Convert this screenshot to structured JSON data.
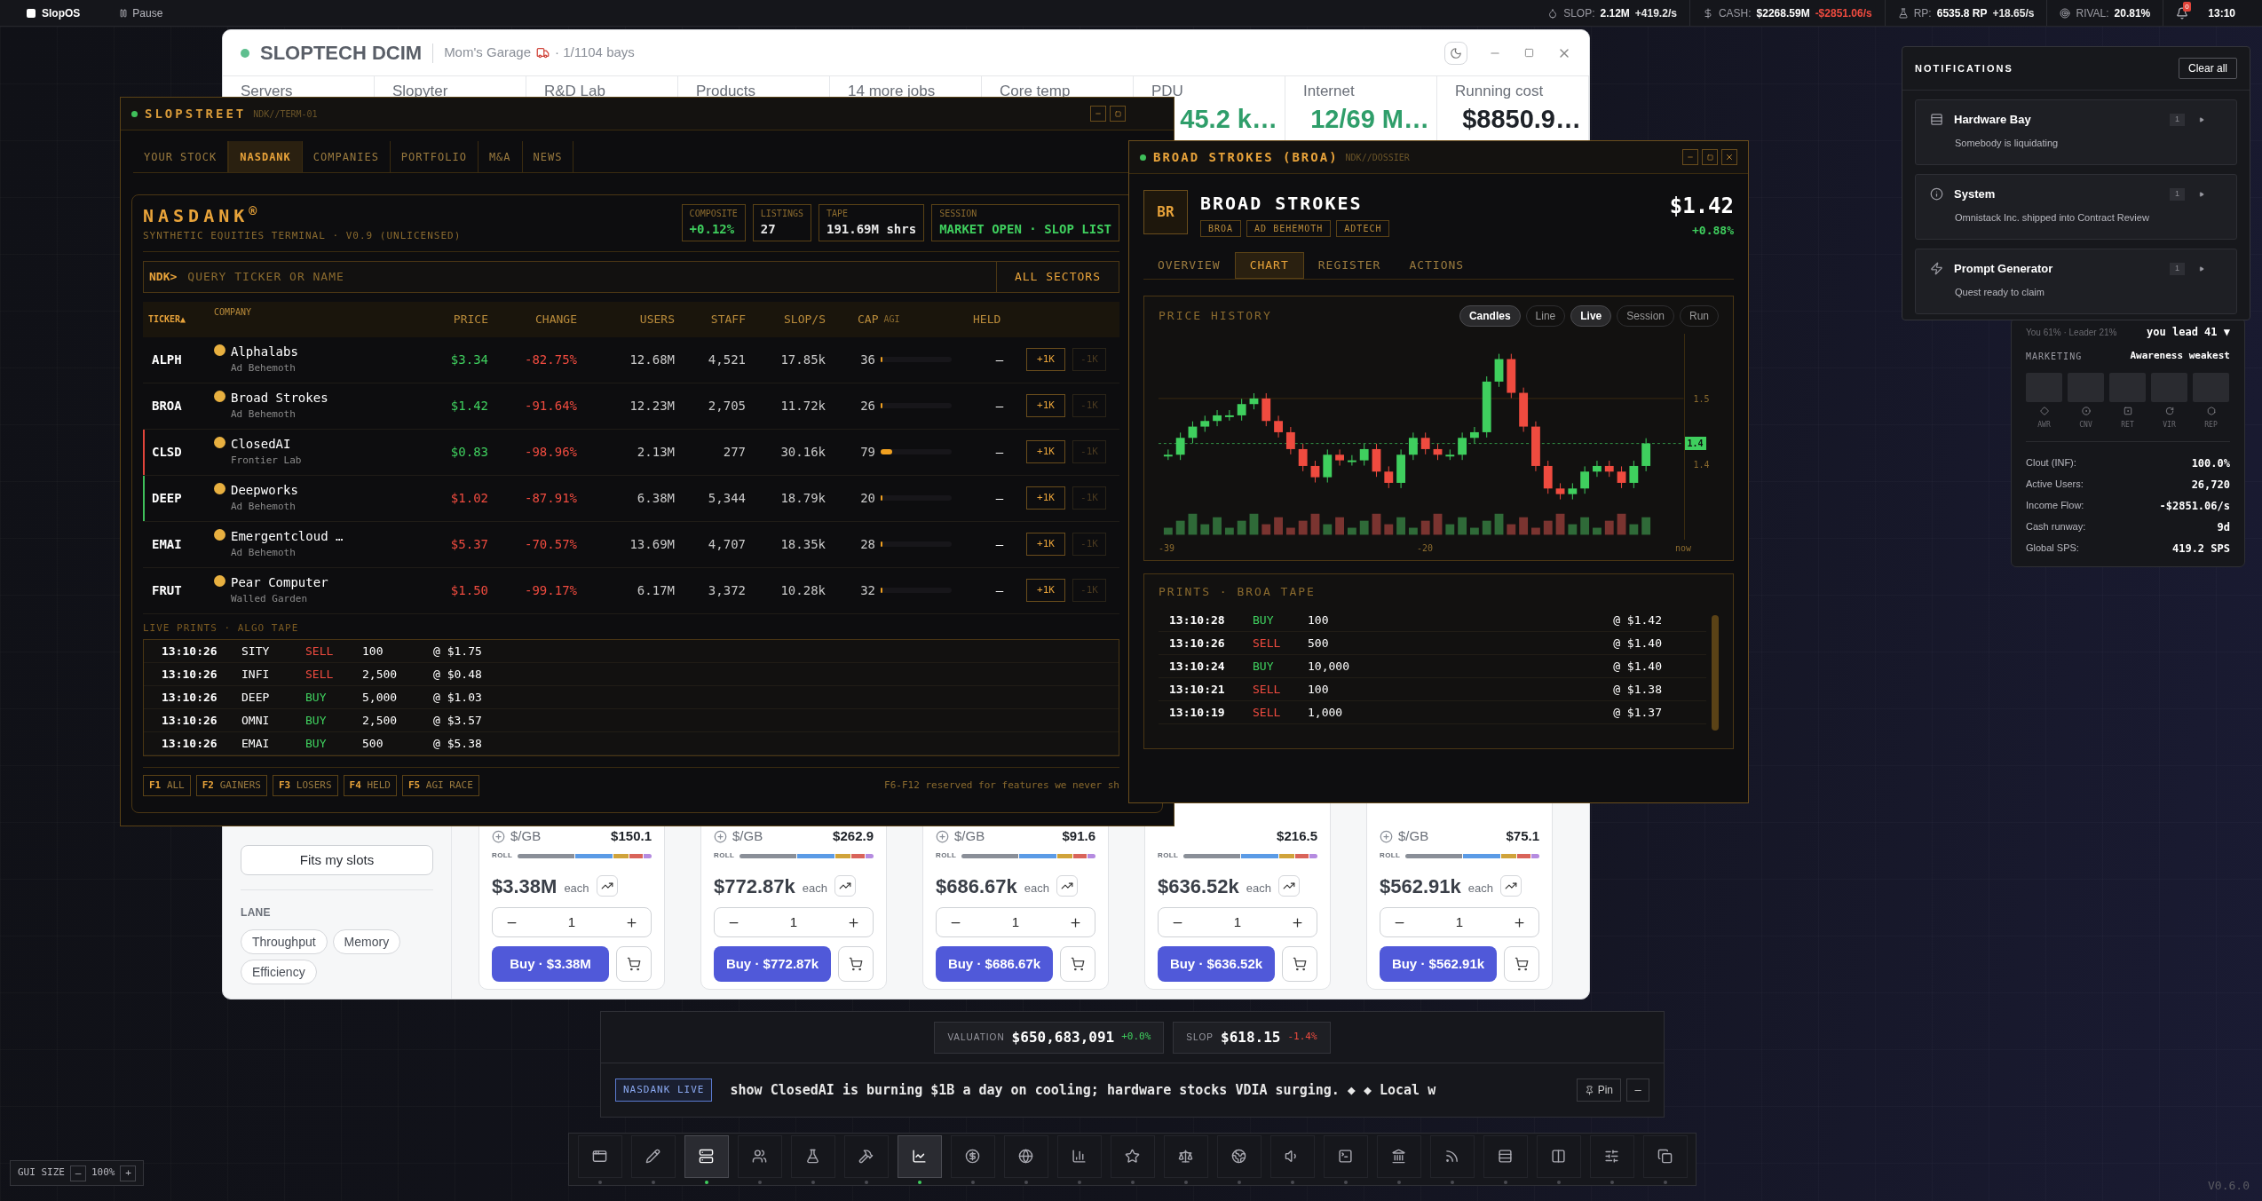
{
  "topbar": {
    "app": "SlopOS",
    "pause": "Pause",
    "stats": [
      {
        "label": "SLOP:",
        "value": "2.12M",
        "rate": "+419.2/s",
        "negative": false
      },
      {
        "label": "CASH:",
        "value": "$2268.59M",
        "rate": "-$2851.06/s",
        "negative": true
      },
      {
        "label": "RP:",
        "value": "6535.8 RP",
        "rate": "+18.65/s",
        "negative": false
      },
      {
        "label": "RIVAL:",
        "value": "20.81%"
      }
    ],
    "alerts": "0",
    "clock": "13:10"
  },
  "dcim": {
    "title": "SLOPTECH DCIM",
    "location": "Mom's Garage",
    "bays": "· 1/1104 bays",
    "stats": [
      {
        "label": "Servers"
      },
      {
        "label": "Slopyter"
      },
      {
        "label": "R&D Lab"
      },
      {
        "label": "Products"
      },
      {
        "label": "14 more jobs"
      },
      {
        "label": "Core temp"
      },
      {
        "label": "PDU",
        "value": "45.2 k…",
        "healthy": true
      },
      {
        "label": "Internet",
        "value": "12/69 M…",
        "healthy": true
      },
      {
        "label": "Running cost",
        "value": "$8850.9…",
        "healthy": false
      }
    ],
    "filters": {
      "button": "Fits my slots",
      "lane_label": "LANE",
      "chips": [
        "Throughput",
        "Memory",
        "Efficiency"
      ]
    },
    "cards": [
      {
        "unit": "$/GB",
        "per_gb": "$150.1",
        "roll": "ROLL",
        "price": "$3.38M",
        "each": "each",
        "qty": "1",
        "buy": "Buy · $3.38M"
      },
      {
        "unit": "$/GB",
        "per_gb": "$262.9",
        "roll": "ROLL",
        "price": "$772.87k",
        "each": "each",
        "qty": "1",
        "buy": "Buy · $772.87k"
      },
      {
        "unit": "$/GB",
        "per_gb": "$91.6",
        "roll": "ROLL",
        "price": "$686.67k",
        "each": "each",
        "qty": "1",
        "buy": "Buy · $686.67k"
      },
      {
        "per_gb": "$216.5",
        "roll": "ROLL",
        "price": "$636.52k",
        "each": "each",
        "qty": "1",
        "buy": "Buy · $636.52k"
      },
      {
        "unit": "$/GB",
        "per_gb": "$75.1",
        "roll": "ROLL",
        "price": "$562.91k",
        "each": "each",
        "qty": "1",
        "buy": "Buy · $562.91k"
      }
    ]
  },
  "slopstreet": {
    "title": "SLOPSTREET",
    "path": "NDK//TERM-01",
    "tabs": [
      {
        "label": "YOUR STOCK",
        "selected": false
      },
      {
        "label": "NASDANK",
        "selected": true
      },
      {
        "label": "COMPANIES",
        "selected": false
      },
      {
        "label": "PORTFOLIO",
        "selected": false
      },
      {
        "label": "M&A",
        "selected": false
      },
      {
        "label": "NEWS",
        "selected": false
      }
    ],
    "brand": "NASDANK$^{®}$",
    "subtitle": "SYNTHETIC EQUITIES TERMINAL · V0.9 (UNLICENSED)",
    "metrics": [
      {
        "label": "COMPOSITE",
        "value": "+0.12%",
        "positive": true
      },
      {
        "label": "LISTINGS",
        "value": "27",
        "positive": false
      },
      {
        "label": "TAPE",
        "value": "191.69M shrs",
        "positive": false
      },
      {
        "label": "SESSION",
        "value": "MARKET OPEN · SLOP LIST",
        "positive": true
      }
    ],
    "query": {
      "prompt": "NDK>",
      "placeholder": "QUERY TICKER OR NAME",
      "sector": "ALL SECTORS"
    },
    "columns": [
      "TICKER▲",
      "COMPANY",
      "PRICE",
      "CHANGE",
      "USERS",
      "STAFF",
      "SLOP/S",
      "CAP",
      "AGI",
      "HELD"
    ],
    "rows": [
      {
        "ticker": "ALPH",
        "name": "Alphalabs",
        "sector": "Ad Behemoth",
        "price": "$3.34",
        "up": true,
        "change": "-82.75%",
        "users": "12.68M",
        "staff": "4,521",
        "slop": "17.85k",
        "cap": "36",
        "level": 0.03,
        "held": "—",
        "buy": "+1K",
        "sell": "-1K",
        "sell_disabled": true
      },
      {
        "ticker": "BROA",
        "name": "Broad Strokes",
        "sector": "Ad Behemoth",
        "price": "$1.42",
        "up": true,
        "change": "-91.64%",
        "users": "12.23M",
        "staff": "2,705",
        "slop": "11.72k",
        "cap": "26",
        "level": 0.03,
        "held": "—",
        "buy": "+1K",
        "sell": "-1K",
        "sell_disabled": true
      },
      {
        "ticker": "CLSD",
        "name": "ClosedAI",
        "sector": "Frontier Lab",
        "price": "$0.83",
        "up": true,
        "change": "-98.96%",
        "users": "2.13M",
        "staff": "277",
        "slop": "30.16k",
        "cap": "79",
        "level": 0.16,
        "held": "—",
        "buy": "+1K",
        "sell": "-1K",
        "sell_disabled": true,
        "color": "#e0443a"
      },
      {
        "ticker": "DEEP",
        "name": "Deepworks",
        "sector": "Ad Behemoth",
        "price": "$1.02",
        "up": false,
        "change": "-87.91%",
        "users": "6.38M",
        "staff": "5,344",
        "slop": "18.79k",
        "cap": "20",
        "level": 0.03,
        "held": "—",
        "buy": "+1K",
        "sell": "-1K",
        "sell_disabled": true,
        "color": "#3fbf5a"
      },
      {
        "ticker": "EMAI",
        "name": "Emergentcloud …",
        "sector": "Ad Behemoth",
        "price": "$5.37",
        "up": false,
        "change": "-70.57%",
        "users": "13.69M",
        "staff": "4,707",
        "slop": "18.35k",
        "cap": "28",
        "level": 0.03,
        "held": "—",
        "buy": "+1K",
        "sell": "-1K",
        "sell_disabled": true
      },
      {
        "ticker": "FRUT",
        "name": "Pear Computer",
        "sector": "Walled Garden",
        "price": "$1.50",
        "up": false,
        "change": "-99.17%",
        "users": "6.17M",
        "staff": "3,372",
        "slop": "10.28k",
        "cap": "32",
        "level": 0.03,
        "held": "—",
        "buy": "+1K",
        "sell": "-1K",
        "sell_disabled": true
      }
    ],
    "tape_label": "LIVE PRINTS · ALGO TAPE",
    "tape": [
      {
        "time": "13:10:26",
        "ticker": "SITY",
        "side": "SELL",
        "kind": "sell",
        "qty": "100",
        "price": "@ $1.75"
      },
      {
        "time": "13:10:26",
        "ticker": "INFI",
        "side": "SELL",
        "kind": "sell",
        "qty": "2,500",
        "price": "@ $0.48"
      },
      {
        "time": "13:10:26",
        "ticker": "DEEP",
        "side": "BUY",
        "kind": "buy",
        "qty": "5,000",
        "price": "@ $1.03"
      },
      {
        "time": "13:10:26",
        "ticker": "OMNI",
        "side": "BUY",
        "kind": "buy",
        "qty": "2,500",
        "price": "@ $3.57"
      },
      {
        "time": "13:10:26",
        "ticker": "EMAI",
        "side": "BUY",
        "kind": "buy",
        "qty": "500",
        "price": "@ $5.38"
      }
    ],
    "fkeys": [
      {
        "key": "F1",
        "label": "ALL"
      },
      {
        "key": "F2",
        "label": "GAINERS"
      },
      {
        "key": "F3",
        "label": "LOSERS"
      },
      {
        "key": "F4",
        "label": "HELD"
      },
      {
        "key": "F5",
        "label": "AGI RACE"
      }
    ],
    "footer_note": "F6-F12 reserved for features we never sh"
  },
  "dossier": {
    "title": "BROAD STROKES (BROA)",
    "path": "NDK//DOSSIER",
    "initials": "BR",
    "name": "BROAD STROKES",
    "tags": [
      "BROA",
      "AD BEHEMOTH",
      "ADTECH"
    ],
    "price": "$1.42",
    "change": "+0.88%",
    "up": true,
    "tabs": [
      {
        "label": "OVERVIEW",
        "selected": false
      },
      {
        "label": "CHART",
        "selected": true
      },
      {
        "label": "REGISTER",
        "selected": false
      },
      {
        "label": "ACTIONS",
        "selected": false
      }
    ],
    "chart_title": "PRICE HISTORY",
    "styles": [
      {
        "label": "Candles",
        "selected": true
      },
      {
        "label": "Line",
        "selected": false
      }
    ],
    "ranges": [
      {
        "label": "Live",
        "selected": true
      },
      {
        "label": "Session",
        "selected": false
      },
      {
        "label": "Run",
        "selected": false
      }
    ],
    "y_labels": [
      "1.5",
      "1.4"
    ],
    "last_tag": "1.4",
    "x_labels": [
      "-39",
      "-20",
      "now"
    ],
    "tape_title": "PRINTS · BROA TAPE",
    "tape": [
      {
        "time": "13:10:28",
        "side": "BUY",
        "kind": "buy",
        "qty": "100",
        "price": "@ $1.42"
      },
      {
        "time": "13:10:26",
        "side": "SELL",
        "kind": "sell",
        "qty": "500",
        "price": "@ $1.40"
      },
      {
        "time": "13:10:24",
        "side": "BUY",
        "kind": "buy",
        "qty": "10,000",
        "price": "@ $1.40"
      },
      {
        "time": "13:10:21",
        "side": "SELL",
        "kind": "sell",
        "qty": "100",
        "price": "@ $1.38"
      },
      {
        "time": "13:10:19",
        "side": "SELL",
        "kind": "sell",
        "qty": "1,000",
        "price": "@ $1.37"
      }
    ]
  },
  "notifications": {
    "title": "NOTIFICATIONS",
    "clear": "Clear all",
    "items": [
      {
        "title": "Hardware Bay",
        "count": "1",
        "message": "Somebody is liquidating"
      },
      {
        "title": "System",
        "count": "1",
        "message": "Omnistack Inc. shipped into Contract Review"
      },
      {
        "title": "Prompt Generator",
        "count": "1",
        "message": "Quest ready to claim"
      }
    ]
  },
  "rival_panel": {
    "standing": "You 61% · Leader 21%",
    "lead": "you lead 41 ▼",
    "marketing": "MARKETING",
    "note": "Awareness weakest",
    "slots": [
      "AWR",
      "CNV",
      "RET",
      "VIR",
      "REP"
    ],
    "stats": [
      {
        "label": "Clout (INF):",
        "value": "100.0%"
      },
      {
        "label": "Active Users:",
        "value": "26,720"
      },
      {
        "label": "Income Flow:",
        "value": "-$2851.06/s"
      },
      {
        "label": "Cash runway:",
        "value": "9d"
      },
      {
        "label": "Global SPS:",
        "value": "419.2 SPS"
      }
    ]
  },
  "ticker": {
    "chips": [
      {
        "label": "VALUATION",
        "value": "$650,683,091",
        "change": "+0.0%",
        "up": true
      },
      {
        "label": "SLOP",
        "value": "$618.15",
        "change": "-1.4%",
        "up": false
      }
    ],
    "badge": "NASDANK LIVE",
    "text": "show ClosedAI is burning $1B a day on cooling; hardware stocks VDIA surging. ◆ ◆ Local w",
    "pin": "Pin",
    "collapse": "–"
  },
  "dock": [
    {
      "selected": false
    },
    {
      "selected": false
    },
    {
      "selected": true
    },
    {
      "selected": false
    },
    {
      "selected": false
    },
    {
      "selected": false
    },
    {
      "selected": true
    },
    {
      "selected": false
    },
    {
      "selected": false
    },
    {
      "selected": false
    },
    {
      "selected": false
    },
    {
      "selected": false
    },
    {
      "selected": false
    },
    {
      "selected": false
    },
    {
      "selected": false
    },
    {
      "selected": false
    },
    {
      "selected": false
    },
    {
      "selected": false
    },
    {
      "selected": false
    },
    {
      "selected": false
    },
    {
      "selected": false
    }
  ],
  "gui_size": {
    "label": "GUI SIZE",
    "minus": "–",
    "value": "100%",
    "plus": "+"
  },
  "version": "V0.6.0"
}
